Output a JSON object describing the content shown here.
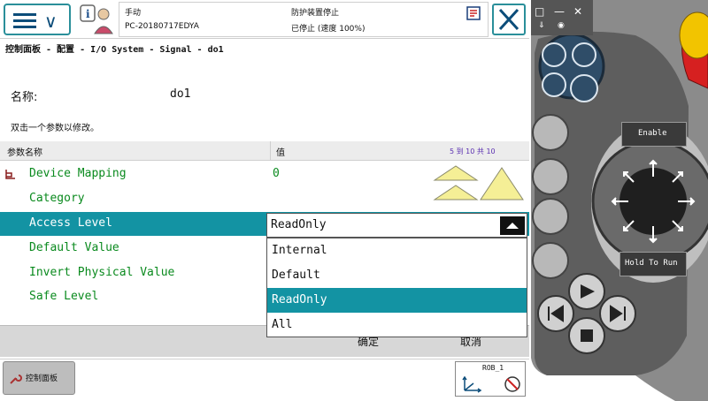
{
  "status": {
    "mode": "手动",
    "controller": "PC-20180717EDYA",
    "safety": "防护装置停止",
    "state": "已停止 (速度 100%)"
  },
  "breadcrumb": "控制面板 - 配置 - I/O System - Signal - do1",
  "form": {
    "name_label": "名称:",
    "name_value": "do1",
    "instruction": "双击一个参数以修改。"
  },
  "table": {
    "col_name": "参数名称",
    "col_value": "值",
    "page_info": "5 到 10 共 10",
    "rows": [
      {
        "label": "Device Mapping",
        "value": "0"
      },
      {
        "label": "Category",
        "value": ""
      },
      {
        "label": "Access Level",
        "value": ""
      },
      {
        "label": "Default Value",
        "value": ""
      },
      {
        "label": "Invert Physical Value",
        "value": ""
      },
      {
        "label": "Safe Level",
        "value": ""
      }
    ]
  },
  "dropdown": {
    "selected": "ReadOnly",
    "options": [
      "Internal",
      "Default",
      "ReadOnly",
      "All"
    ]
  },
  "buttons": {
    "ok": "确定",
    "cancel": "取消"
  },
  "taskbar": {
    "control_panel": "控制面板",
    "robot": "ROB_1"
  },
  "flexpendant": {
    "enable": "Enable",
    "hold_to_run": "Hold To Run"
  },
  "colors": {
    "accent": "#1393a3",
    "param_text": "#0a8a1e",
    "border_accent": "#2a8f9a"
  }
}
